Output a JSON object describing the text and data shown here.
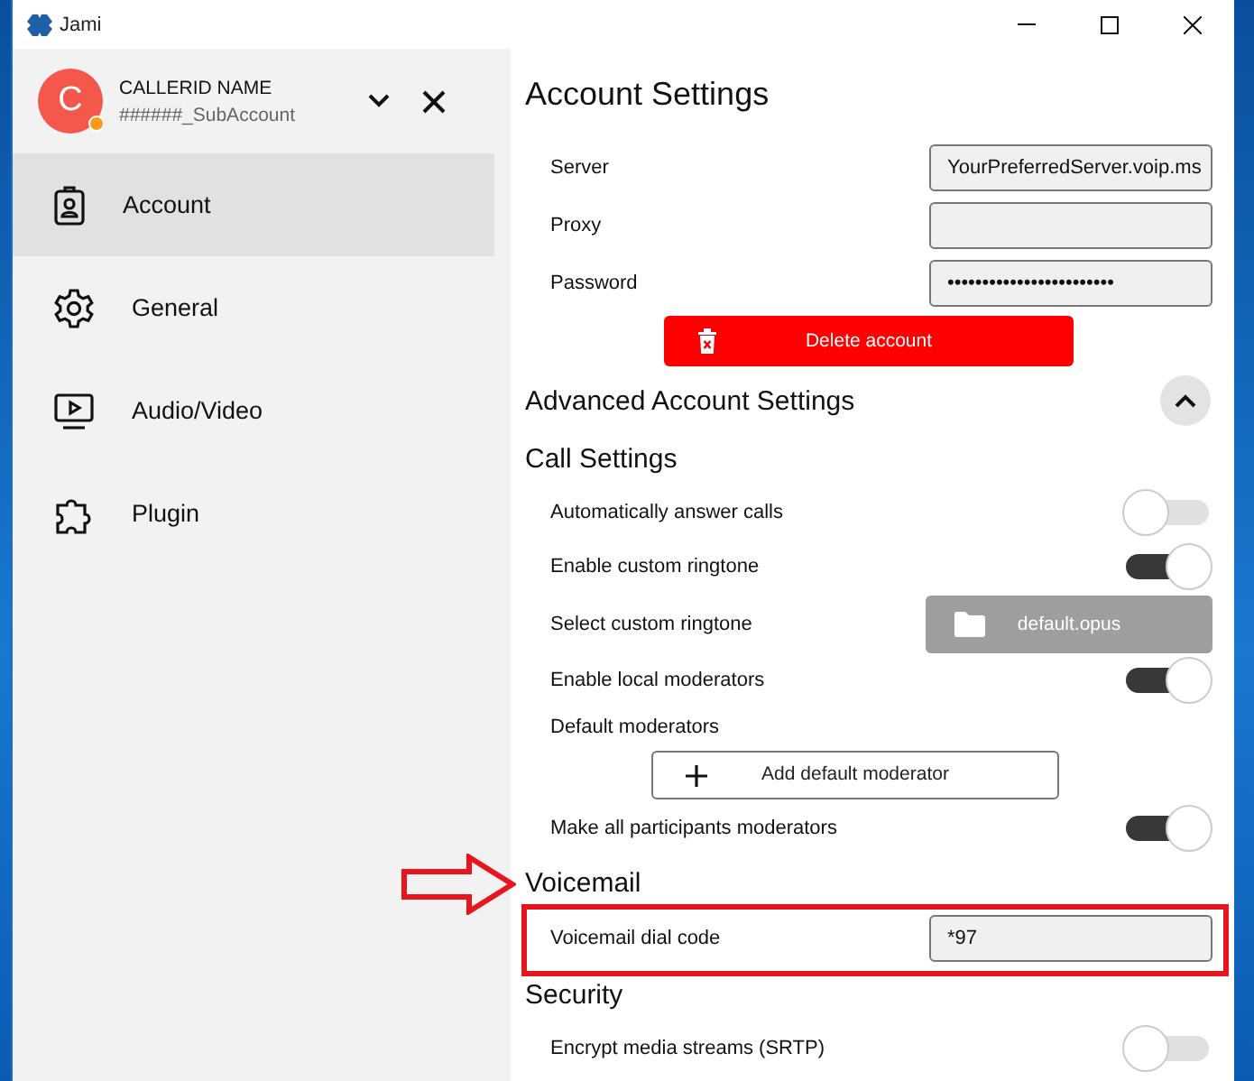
{
  "window": {
    "title": "Jami"
  },
  "account": {
    "initial": "C",
    "name": "CALLERID NAME",
    "subtitle": "######_SubAccount"
  },
  "sidebar": {
    "items": [
      {
        "label": "Account",
        "kind": "account",
        "selected": true
      },
      {
        "label": "General",
        "kind": "general",
        "selected": false
      },
      {
        "label": "Audio/Video",
        "kind": "media",
        "selected": false
      },
      {
        "label": "Plugin",
        "kind": "plugin",
        "selected": false
      }
    ]
  },
  "content": {
    "title": "Account Settings",
    "rows": [
      {
        "kind": "field",
        "label": "Server",
        "value": "YourPreferredServer.voip.ms"
      },
      {
        "kind": "field",
        "label": "Proxy",
        "value": ""
      },
      {
        "kind": "field",
        "label": "Password",
        "value": "••••••••••••••••••••••••"
      },
      {
        "kind": "danger",
        "label": "Delete account"
      },
      {
        "kind": "section",
        "label": "Advanced Account Settings",
        "expanded": true
      },
      {
        "kind": "heading",
        "label": "Call Settings"
      },
      {
        "kind": "toggle",
        "label": "Automatically answer calls",
        "on": false
      },
      {
        "kind": "toggle",
        "label": "Enable custom ringtone",
        "on": true
      },
      {
        "kind": "file",
        "label": "Select custom ringtone",
        "value": "default.opus"
      },
      {
        "kind": "toggle",
        "label": "Enable local moderators",
        "on": true
      },
      {
        "kind": "label",
        "label": "Default moderators"
      },
      {
        "kind": "add",
        "label": "Add default moderator"
      },
      {
        "kind": "toggle",
        "label": "Make all participants moderators",
        "on": true
      },
      {
        "kind": "heading",
        "label": "Voicemail"
      },
      {
        "kind": "field",
        "label": "Voicemail dial code",
        "value": "*97"
      },
      {
        "kind": "heading",
        "label": "Security"
      },
      {
        "kind": "toggle",
        "label": "Encrypt media streams (SRTP)",
        "on": false
      }
    ]
  }
}
